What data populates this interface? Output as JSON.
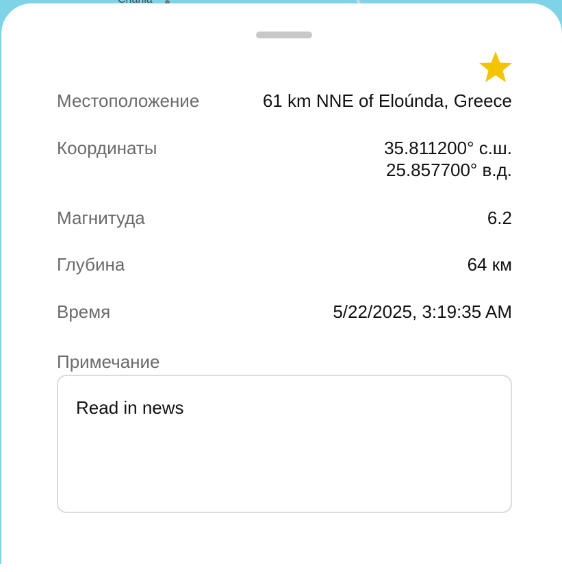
{
  "map": {
    "place_label": "Chania"
  },
  "sheet": {
    "favorite": {
      "icon": "star-icon",
      "active": true,
      "color": "#f5c400"
    },
    "details": [
      {
        "label": "Местоположение",
        "value": "61 km NNE of Eloúnda, Greece"
      },
      {
        "label": "Координаты",
        "value_line1": "35.811200° с.ш.",
        "value_line2": "25.857700° в.д."
      },
      {
        "label": "Магнитуда",
        "value": "6.2"
      },
      {
        "label": "Глубина",
        "value": "64 км"
      },
      {
        "label": "Время",
        "value": "5/22/2025, 3:19:35 AM"
      }
    ],
    "note": {
      "label": "Примечание",
      "value": "Read in news"
    }
  },
  "colors": {
    "map_water": "#7fd3e6",
    "label_text": "#6b6b6b",
    "value_text": "#111111",
    "star": "#f5c400"
  }
}
